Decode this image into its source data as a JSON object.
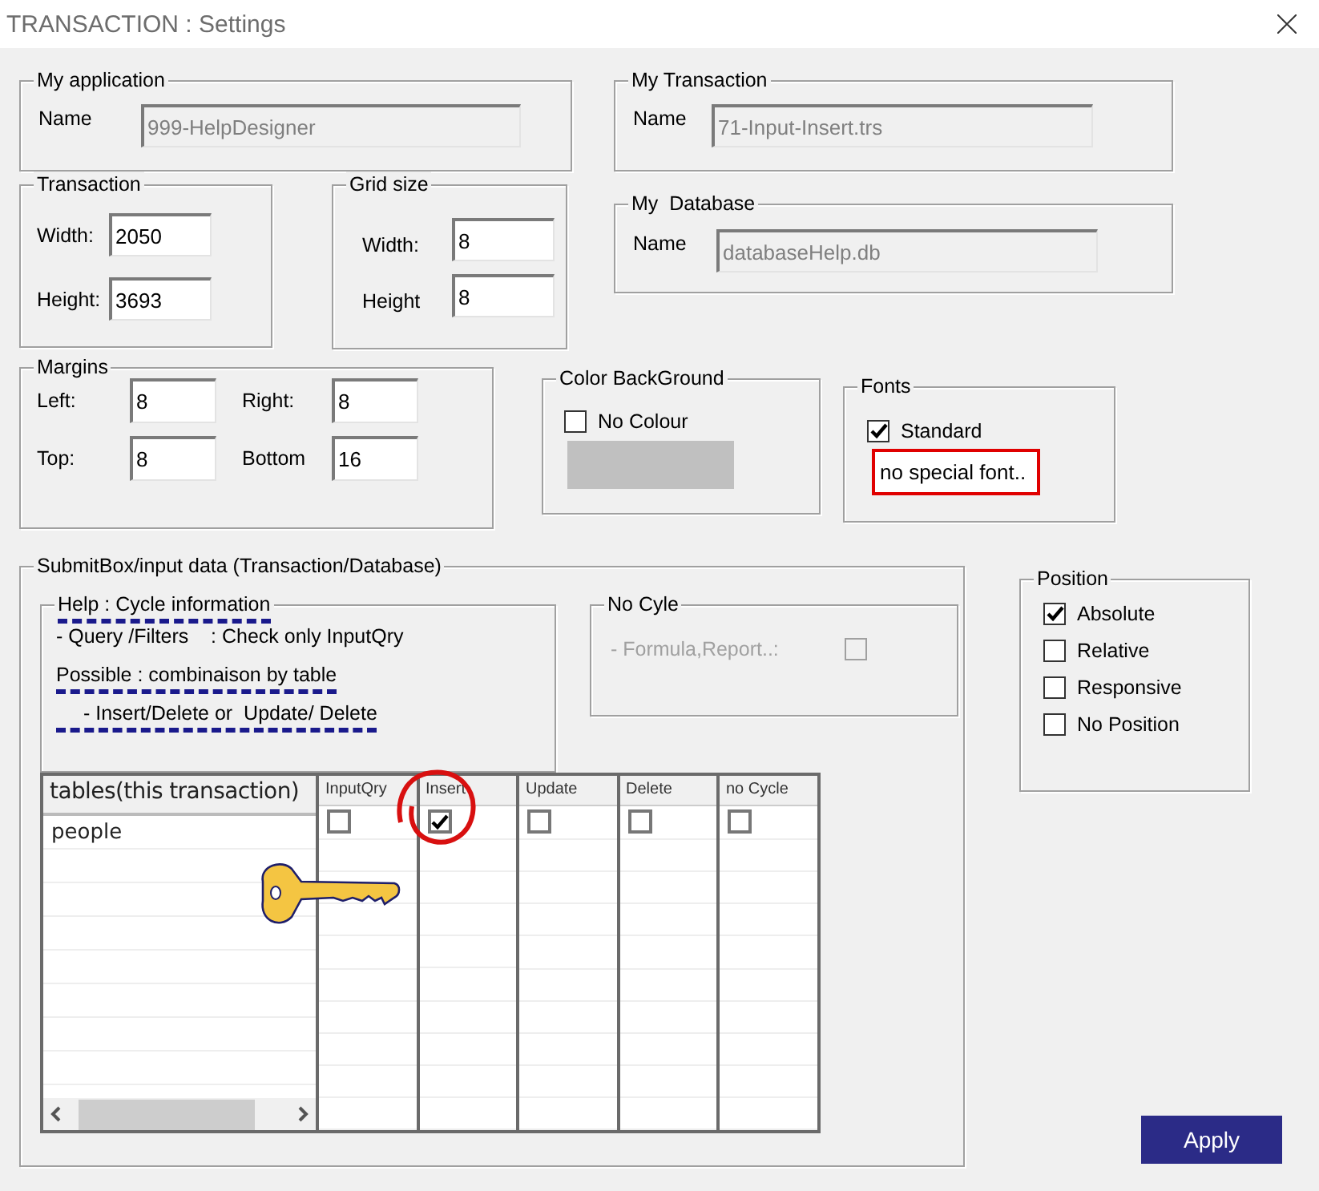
{
  "window": {
    "title": "TRANSACTION : Settings"
  },
  "my_application": {
    "title": "My application",
    "name_label": "Name",
    "name_value": "999-HelpDesigner",
    "disabled": true
  },
  "my_transaction": {
    "title": "My Transaction",
    "name_label": "Name",
    "name_value": "71-Input-Insert.trs",
    "disabled": true
  },
  "transaction": {
    "title": "Transaction",
    "fields": [
      {
        "label": "Width:",
        "value": "2050"
      },
      {
        "label": "Height:",
        "value": "3693"
      }
    ]
  },
  "grid_size": {
    "title": "Grid size",
    "fields": [
      {
        "label": "Width:",
        "value": "8"
      },
      {
        "label": "Height",
        "value": "8"
      }
    ]
  },
  "my_database": {
    "title": "My  Database",
    "name_label": "Name",
    "name_value": "databaseHelp.db",
    "disabled": true
  },
  "margins": {
    "title": "Margins",
    "fields": [
      {
        "label": "Left:",
        "value": "8"
      },
      {
        "label": "Right:",
        "value": "8"
      },
      {
        "label": "Top:",
        "value": "8"
      },
      {
        "label": "Bottom",
        "value": "16"
      }
    ]
  },
  "color_background": {
    "title": "Color BackGround",
    "checkbox": {
      "label": "No Colour",
      "checked": false
    }
  },
  "fonts": {
    "title": "Fonts",
    "checkbox": {
      "label": "Standard",
      "checked": true
    },
    "note": "no special font.."
  },
  "submit_box": {
    "title": "SubmitBox/input data (Transaction/Database)",
    "help": {
      "title": "Help : Cycle information",
      "title_underlined": true,
      "lines": [
        {
          "text": "- Query /Filters    : Check only InputQry",
          "underlined": false,
          "indent": false
        },
        {
          "text": "Possible : combinaison by table",
          "underlined": true,
          "indent": false
        },
        {
          "text": "- Insert/Delete or  Update/ Delete",
          "underlined": true,
          "indent": true
        }
      ]
    },
    "no_cycle": {
      "title": "No Cyle",
      "label": "- Formula,Report..:",
      "checked": false,
      "disabled": true
    },
    "table": {
      "columns": [
        "tables(this transaction)",
        "InputQry",
        "Insert",
        "Update",
        "Delete",
        "no Cycle"
      ],
      "rows": [
        {
          "table": "people",
          "checks": [
            false,
            true,
            false,
            false,
            false
          ]
        }
      ]
    }
  },
  "position": {
    "title": "Position",
    "options": [
      {
        "label": "Absolute",
        "checked": true
      },
      {
        "label": "Relative",
        "checked": false
      },
      {
        "label": "Responsive",
        "checked": false
      },
      {
        "label": "No Position",
        "checked": false
      }
    ]
  },
  "apply_button": "Apply"
}
